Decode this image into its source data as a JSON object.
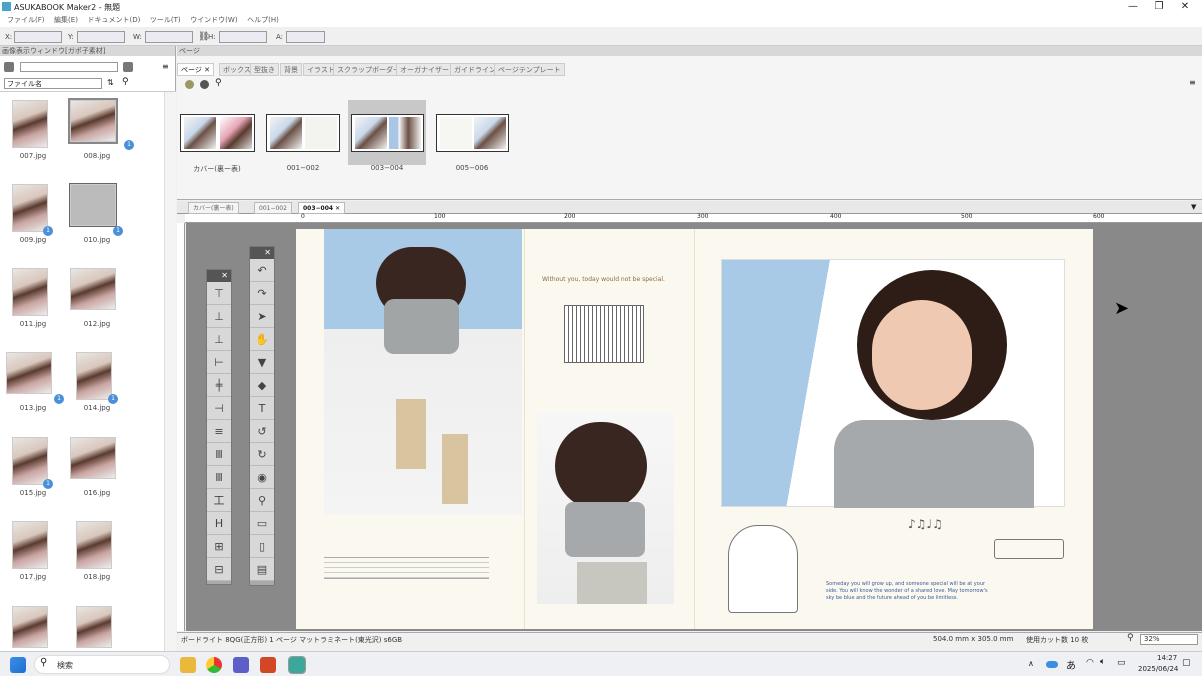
{
  "window": {
    "title": "ASUKABOOK Maker2 - 無題",
    "min": "—",
    "max": "❐",
    "close": "✕"
  },
  "menu": [
    "ファイル(F)",
    "編集(E)",
    "ドキュメント(D)",
    "ツール(T)",
    "ウインドウ(W)",
    "ヘルプ(H)"
  ],
  "coords": {
    "x": "X:",
    "y": "Y:",
    "w": "W:",
    "h": "H:",
    "a": "A:"
  },
  "left_panel": {
    "title": "画像表示ウィンドウ[ガポ子素材]",
    "sort": "ファイル名",
    "images": [
      {
        "name": "007.jpg",
        "badge": ""
      },
      {
        "name": "008.jpg",
        "badge": "1"
      },
      {
        "name": "009.jpg",
        "badge": "1"
      },
      {
        "name": "010.jpg",
        "badge": "1"
      },
      {
        "name": "011.jpg",
        "badge": ""
      },
      {
        "name": "012.jpg",
        "badge": ""
      },
      {
        "name": "013.jpg",
        "badge": "1"
      },
      {
        "name": "014.jpg",
        "badge": "1"
      },
      {
        "name": "015.jpg",
        "badge": "1"
      },
      {
        "name": "016.jpg",
        "badge": ""
      },
      {
        "name": "017.jpg",
        "badge": ""
      },
      {
        "name": "018.jpg",
        "badge": ""
      }
    ]
  },
  "page_panel": {
    "title": "ページ",
    "tabs": [
      "ページ",
      "ボックス",
      "型抜き",
      "背景",
      "イラスト",
      "スクラップボーダー",
      "オーガナイザー",
      "ガイドライン",
      "ページテンプレート"
    ],
    "spreads": [
      "カバー(裏ー表)",
      "001−002",
      "003−004",
      "005−006"
    ]
  },
  "doc_tabs": [
    "カバー(裏ー表)",
    "001−002",
    "003−004"
  ],
  "ruler": {
    "marks": [
      "0",
      "100",
      "200",
      "300",
      "400",
      "500",
      "600"
    ]
  },
  "page_text": {
    "caption": "Without you, today would not be special.",
    "story": "Someday you will grow up, and someone special will be at your side. You will know the wonder of a shared love. May tomorrow's sky be blue and the future ahead of you be limitless."
  },
  "status": {
    "left": "ボードライト 8QG(正方形) 1 ページ マットラミネート(東光沢) s6GB",
    "size": "504.0 mm x 305.0 mm",
    "count": "使用カット数 10 枚",
    "zoom": "32%"
  },
  "taskbar": {
    "search": "検索",
    "time": "14:27",
    "date": "2025/06/24",
    "ime": "あ"
  }
}
